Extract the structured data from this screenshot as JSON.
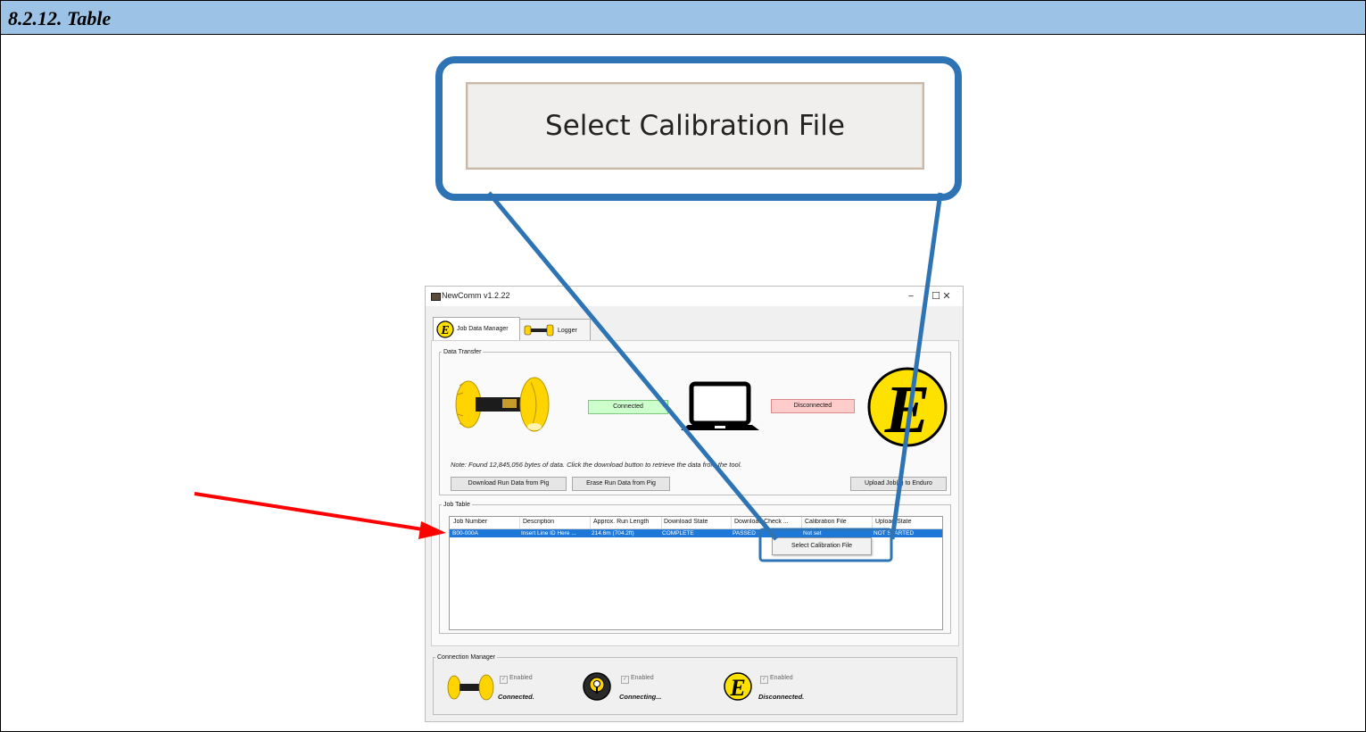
{
  "document": {
    "heading": "8.2.12. Table"
  },
  "callout": {
    "button_label": "Select Calibration File",
    "outline_color": "#2e74b5",
    "arrow_color": "#ff0000"
  },
  "window": {
    "title": "NewComm v1.2.22",
    "controls": {
      "minimize": "−",
      "maximize": "☐",
      "close": "✕"
    },
    "tabs": [
      {
        "label": "Job Data Manager"
      },
      {
        "label": "Logger"
      }
    ],
    "data_transfer": {
      "legend": "Data Transfer",
      "status_left": "Connected",
      "status_right": "Disconnected",
      "note": "Note: Found 12,845,056 bytes of data. Click the download button to retrieve the data from the tool.",
      "buttons": {
        "download": "Download Run Data from Pig",
        "erase": "Erase Run Data from Pig",
        "upload": "Upload Job(s) to Enduro"
      }
    },
    "job_table": {
      "legend": "Job Table",
      "columns": [
        "Job Number",
        "Description",
        "Approx. Run Length",
        "Download State",
        "Download Check ...",
        "Calibration File",
        "Upload State"
      ],
      "rows": [
        {
          "job_number": "B00-000A",
          "description": "Insert Line ID Here ...",
          "run_length": "214.6m (704.2ft)",
          "download_state": "COMPLETE",
          "download_check": "PASSED",
          "calibration_file": "Not set",
          "upload_state": "NOT STARTED"
        }
      ],
      "selected_row_color": "#1e78d7"
    },
    "context_menu": {
      "item": "Select Calibration File"
    },
    "connection_manager": {
      "legend": "Connection Manager",
      "items": [
        {
          "enabled_label": "Enabled",
          "status": "Connected."
        },
        {
          "enabled_label": "Enabled",
          "status": "Connecting..."
        },
        {
          "enabled_label": "Enabled",
          "status": "Disconnected."
        }
      ]
    }
  }
}
